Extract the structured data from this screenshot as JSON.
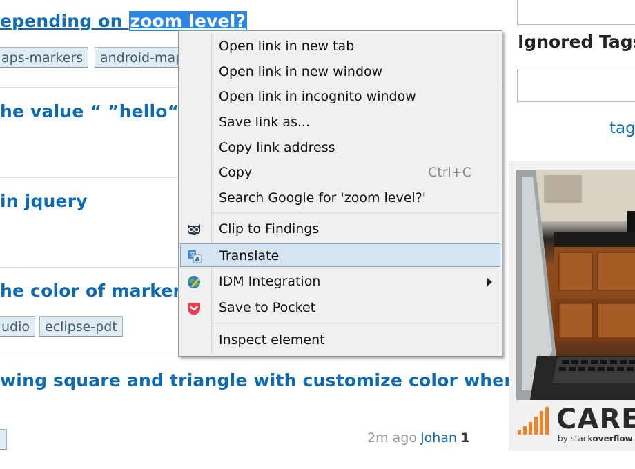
{
  "questions": [
    {
      "title_plain": "epending on ",
      "title_selected": "zoom level?",
      "tags": [
        "aps-markers",
        "android-map"
      ]
    },
    {
      "title": "he value “ ”hello“ "
    },
    {
      "title": "in jquery"
    },
    {
      "title": "he color of markers",
      "tags": [
        "udio",
        "eclipse-pdt"
      ]
    },
    {
      "title": "wing square and triangle with customize color when",
      "time": "2m ago",
      "user": "Johan",
      "rep": "1"
    }
  ],
  "sidebar": {
    "ignored_tags_label": "Ignored Tags",
    "tag_link": "tag",
    "ad": {
      "word": "CARE",
      "byline_prefix": "by stack",
      "byline_bold": "overflow"
    }
  },
  "context_menu": {
    "items": [
      {
        "label": "Open link in new tab"
      },
      {
        "label": "Open link in new window"
      },
      {
        "label": "Open link in incognito window"
      },
      {
        "label": "Save link as..."
      },
      {
        "label": "Copy link address"
      },
      {
        "label": "Copy",
        "shortcut": "Ctrl+C"
      },
      {
        "label": "Search Google for 'zoom level?'"
      },
      {
        "label": "Clip to Findings",
        "icon": "owl-icon"
      },
      {
        "label": "Translate",
        "icon": "translate-icon",
        "highlighted": true
      },
      {
        "label": "IDM Integration",
        "icon": "idm-globe-icon",
        "submenu": true
      },
      {
        "label": "Save to Pocket",
        "icon": "pocket-icon"
      },
      {
        "label": "Inspect element"
      }
    ]
  },
  "colors": {
    "link_blue": "#0e6ab1",
    "selection": "#2f86e0",
    "menu_bg": "#f0f0f0",
    "menu_highlight": "#d6e3f1",
    "pocket_red": "#e8404f"
  }
}
